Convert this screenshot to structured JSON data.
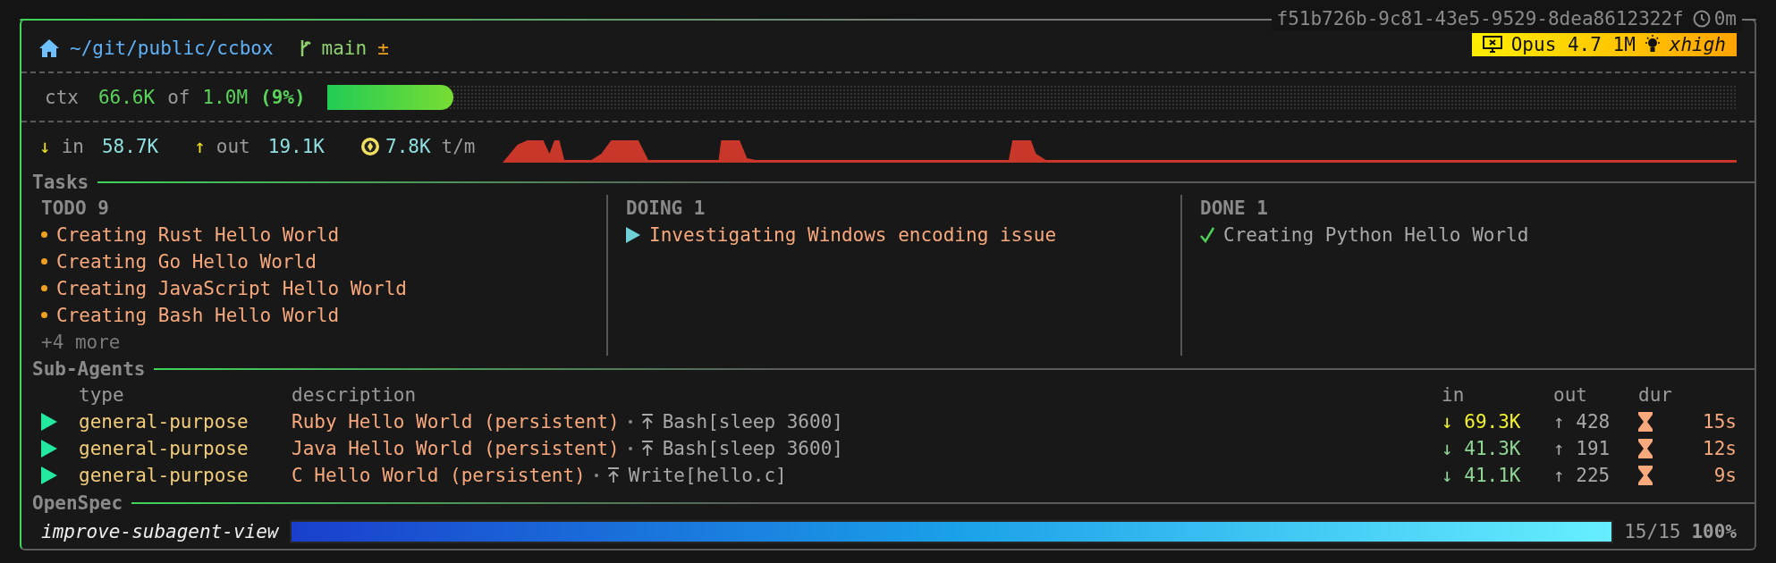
{
  "session": {
    "id": "f51b726b-9c81-43e5-9529-8dea8612322f",
    "elapsed": "0m"
  },
  "header": {
    "path": "~/git/public/ccbox",
    "branch": "main",
    "dirty_mark": "±",
    "model": "Opus 4.7 1M",
    "effort": "xhigh"
  },
  "context": {
    "label": "ctx",
    "used": "66.6K",
    "of": "of",
    "total": "1.0M",
    "percent": "(9%)",
    "level": 0.09
  },
  "throughput": {
    "in_arrow": "↓",
    "in_label": "in",
    "in_value": "58.7K",
    "out_arrow": "↑",
    "out_label": "out",
    "out_value": "19.1K",
    "rate": "7.8K",
    "rate_unit": "t/m"
  },
  "tasks": {
    "title": "Tasks",
    "columns": [
      {
        "kind": "todo",
        "heading": "TODO 9",
        "items": [
          "Creating Rust Hello World",
          "Creating Go Hello World",
          "Creating JavaScript Hello World",
          "Creating Bash Hello World"
        ],
        "more": "+4 more"
      },
      {
        "kind": "doing",
        "heading": "DOING 1",
        "items": [
          "Investigating Windows encoding issue"
        ]
      },
      {
        "kind": "done",
        "heading": "DONE 1",
        "items": [
          "Creating Python Hello World"
        ]
      }
    ]
  },
  "sub_agents": {
    "title": "Sub-Agents",
    "columns": [
      "type",
      "description",
      "in",
      "out",
      "dur"
    ],
    "rows": [
      {
        "type": "general-purpose",
        "description": "Ruby Hello World (persistent)",
        "tool": "Bash[sleep 3600]",
        "in": "↓ 69.3K",
        "color": "#f2f230",
        "out": "↑ 428",
        "dur": "15s"
      },
      {
        "type": "general-purpose",
        "description": "Java Hello World (persistent)",
        "tool": "Bash[sleep 3600]",
        "in": "↓ 41.3K",
        "color": "#8fd694",
        "out": "↑ 191",
        "dur": "12s"
      },
      {
        "type": "general-purpose",
        "description": "C Hello World (persistent)",
        "tool": "Write[hello.c]",
        "in": "↓ 41.1K",
        "color": "#8fd694",
        "out": "↑ 225",
        "dur": "9s"
      }
    ]
  },
  "openspec": {
    "title": "OpenSpec",
    "changes": [
      {
        "name": "improve-subagent-view",
        "level": 1,
        "count": "15/15",
        "percent": "100%"
      }
    ]
  }
}
